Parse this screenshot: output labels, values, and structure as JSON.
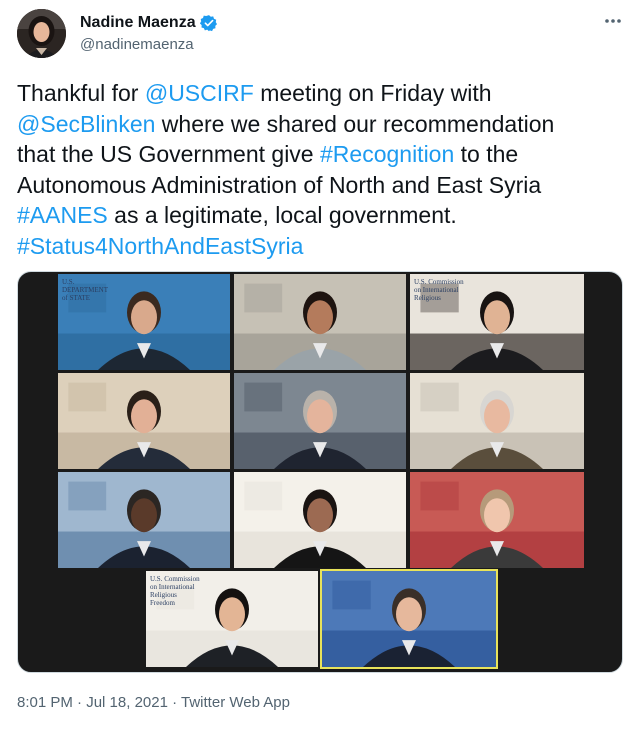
{
  "author": {
    "display_name": "Nadine Maenza",
    "handle": "@nadinemaenza",
    "verified": true,
    "verified_icon": "verified-badge-icon",
    "more_icon": "more-horizontal-icon"
  },
  "tweet": {
    "lines": [
      [
        {
          "t": "Thankful for ",
          "link": false
        },
        {
          "t": "@USCIRF",
          "link": true
        },
        {
          "t": " meeting on Friday with",
          "link": false
        }
      ],
      [
        {
          "t": "@SecBlinken",
          "link": true
        },
        {
          "t": " where we shared our recommendation",
          "link": false
        }
      ],
      [
        {
          "t": "that the US Government give ",
          "link": false
        },
        {
          "t": "#Recognition",
          "link": true
        },
        {
          "t": " to the",
          "link": false
        }
      ],
      [
        {
          "t": "Autonomous Administration of North and East Syria",
          "link": false
        }
      ],
      [
        {
          "t": "#AANES",
          "link": true
        },
        {
          "t": " as a legitimate, local government.",
          "link": false
        }
      ],
      [
        {
          "t": "#Status4NorthAndEastSyria",
          "link": true
        }
      ]
    ]
  },
  "media": {
    "alt": "Video conference meeting grid",
    "tiles": [
      {
        "bg": "#2f6fa3",
        "wall": "#3a7fb8",
        "skin": "#d9a98c",
        "hair": "#3b2a20",
        "suit": "#1d2733",
        "label": "U.S. DEPARTMENT of STATE"
      },
      {
        "bg": "#a8a49a",
        "wall": "#c6c1b5",
        "skin": "#b47b5c",
        "hair": "#1e1410",
        "suit": "#9aa3a8",
        "label": ""
      },
      {
        "bg": "#6b6560",
        "wall": "#e9e4dc",
        "skin": "#e0b394",
        "hair": "#181312",
        "suit": "#1b1b1e",
        "label": "U.S. Commission on International Religious"
      },
      {
        "bg": "#c8b9a3",
        "wall": "#ddd0bb",
        "skin": "#e2b096",
        "hair": "#2a1f18",
        "suit": "#242c3a",
        "label": ""
      },
      {
        "bg": "#58616d",
        "wall": "#7d8791",
        "skin": "#e4b49c",
        "hair": "#b9b2aa",
        "suit": "#1f2430",
        "label": ""
      },
      {
        "bg": "#c9c2b6",
        "wall": "#e6e0d4",
        "skin": "#e8b9a0",
        "hair": "#d8d6d2",
        "suit": "#5a4e3c",
        "label": ""
      },
      {
        "bg": "#6f8fb0",
        "wall": "#9fb7cf",
        "skin": "#5a3a2a",
        "hair": "#2b2623",
        "suit": "#1b2230",
        "label": ""
      },
      {
        "bg": "#e8e4dc",
        "wall": "#f4f1ea",
        "skin": "#9c6a52",
        "hair": "#1a1412",
        "suit": "#151515",
        "label": ""
      },
      {
        "bg": "#b34042",
        "wall": "#c85a55",
        "skin": "#f0c6ad",
        "hair": "#b69a7a",
        "suit": "#3a3a3a",
        "label": ""
      },
      {
        "bg": "#e9e6df",
        "wall": "#f2efe9",
        "skin": "#e3b595",
        "hair": "#141110",
        "suit": "#1e2126",
        "label": "U.S. Commission on International Religious Freedom"
      },
      {
        "bg": "#355fa0",
        "wall": "#4d79b8",
        "skin": "#e6b89c",
        "hair": "#3a2f28",
        "suit": "#1a2233",
        "label": ""
      }
    ]
  },
  "footer": {
    "time": "8:01 PM",
    "sep1": " · ",
    "date": "Jul 18, 2021",
    "sep2": " · ",
    "source": "Twitter Web App"
  }
}
